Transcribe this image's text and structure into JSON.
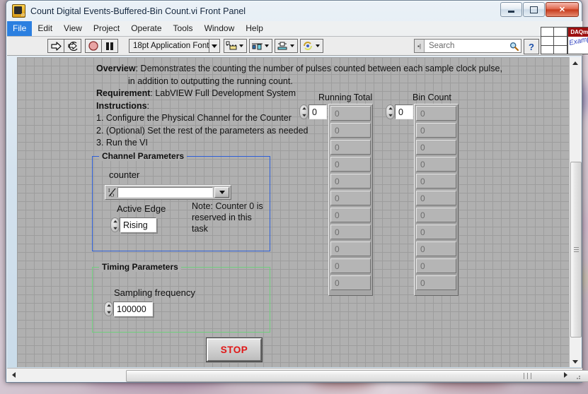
{
  "window": {
    "title": "Count Digital Events-Buffered-Bin Count.vi Front Panel",
    "icon_name": "labview-vi-icon",
    "minimize_label": "",
    "maximize_label": "",
    "close_label": "✕"
  },
  "menubar": {
    "items": [
      {
        "label": "File",
        "active": true
      },
      {
        "label": "Edit",
        "active": false
      },
      {
        "label": "View",
        "active": false
      },
      {
        "label": "Project",
        "active": false
      },
      {
        "label": "Operate",
        "active": false
      },
      {
        "label": "Tools",
        "active": false
      },
      {
        "label": "Window",
        "active": false
      },
      {
        "label": "Help",
        "active": false
      }
    ]
  },
  "toolbar": {
    "run_icon": "run-arrow-icon",
    "run_continuous_icon": "run-continuously-icon",
    "abort_icon": "abort-execution-icon",
    "pause_icon": "pause-icon",
    "font_label": "18pt Application Font",
    "align_icon": "align-objects-icon",
    "distribute_icon": "distribute-objects-icon",
    "resize_icon": "resize-objects-icon",
    "reorder_icon": "reorder-objects-icon",
    "search_placeholder": "Search",
    "search_value": "",
    "search_icon": "magnifier-icon",
    "help_label": "?",
    "minipanel_icon": "window-layout-icon",
    "daqmx_logo_top": "DAQmx",
    "daqmx_logo_bottom": "Example"
  },
  "panel": {
    "overview": [
      {
        "bold": "Overview",
        "rest": ": Demonstrates the counting  the number of pulses counted between each sample clock pulse,",
        "indent": false
      },
      {
        "bold": "",
        "rest": "in addition to outputting the running count.",
        "indent": true
      },
      {
        "bold": "Requirement",
        "rest": ": LabVIEW Full Development System",
        "indent": false
      },
      {
        "bold": "Instructions",
        "rest": ":",
        "indent": false
      },
      {
        "bold": "",
        "rest": "1. Configure the Physical Channel for the Counter",
        "indent": false
      },
      {
        "bold": "",
        "rest": "2. (Optional) Set the rest of the parameters as needed",
        "indent": false
      },
      {
        "bold": "",
        "rest": "3. Run the VI",
        "indent": false
      }
    ],
    "channel_group": {
      "title": "Channel Parameters",
      "border_color": "#2d5fd8",
      "counter_label": "counter",
      "counter_value": "",
      "counter_icon": "io-name-icon",
      "dropdown_icon": "chevron-down-icon",
      "active_edge_label": "Active Edge",
      "active_edge_value": "Rising",
      "note": "Note: Counter 0 is\nreserved in this task",
      "note_line1": "Note: Counter 0 is",
      "note_line2": "reserved in this task"
    },
    "timing_group": {
      "title": "Timing Parameters",
      "border_color": "#6fce7d",
      "sampling_label": "Sampling frequency",
      "sampling_value": "100000"
    },
    "stop_button": {
      "label": "STOP",
      "color": "#e01616"
    },
    "arrays": [
      {
        "title": "Running Total",
        "index_value": "0",
        "cells": [
          "0",
          "0",
          "0",
          "0",
          "0",
          "0",
          "0",
          "0",
          "0",
          "0",
          "0"
        ]
      },
      {
        "title": "Bin Count",
        "index_value": "0",
        "cells": [
          "0",
          "0",
          "0",
          "0",
          "0",
          "0",
          "0",
          "0",
          "0",
          "0",
          "0"
        ]
      }
    ]
  },
  "scrollbars": {
    "v_up_icon": "triangle-up-icon",
    "v_down_icon": "triangle-down-icon",
    "h_left_icon": "triangle-left-icon",
    "h_right_icon": "triangle-right-icon"
  }
}
